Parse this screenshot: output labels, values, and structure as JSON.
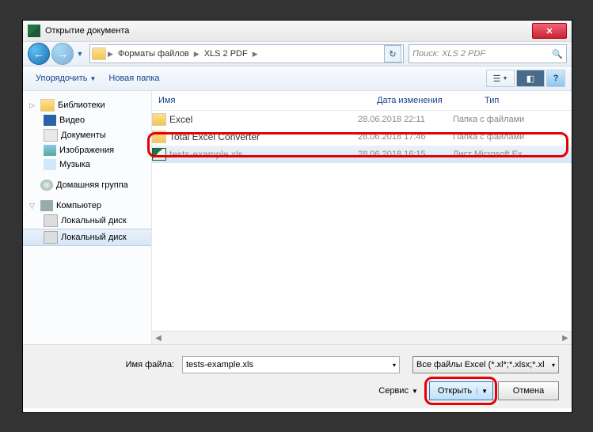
{
  "title": "Открытие документа",
  "breadcrumb": {
    "first": "Форматы файлов",
    "second": "XLS 2 PDF"
  },
  "search_placeholder": "Поиск: XLS 2 PDF",
  "toolbar": {
    "organize": "Упорядочить",
    "new_folder": "Новая папка"
  },
  "sidebar": {
    "libraries": "Библиотеки",
    "video": "Видео",
    "documents": "Документы",
    "images": "Изображения",
    "music": "Музыка",
    "homegroup": "Домашняя группа",
    "computer": "Компьютер",
    "local_disk1": "Локальный диск",
    "local_disk2": "Локальный диск"
  },
  "columns": {
    "name": "Имя",
    "date": "Дата изменения",
    "type": "Тип"
  },
  "files": [
    {
      "name": "Excel",
      "date": "28.06.2018 22:11",
      "type": "Папка с файлами",
      "icon": "folder"
    },
    {
      "name": "Total Excel Converter",
      "date": "28.06.2018 17:46",
      "type": "Папка с файлами",
      "icon": "folder"
    },
    {
      "name": "tests-example.xls",
      "date": "28.06.2018 16:15",
      "type": "Лист Microsoft Ex...",
      "icon": "xls"
    }
  ],
  "filename_label": "Имя файла:",
  "filename_value": "tests-example.xls",
  "filter_value": "Все файлы Excel (*.xl*;*.xlsx;*.xl",
  "service_label": "Сервис",
  "open_label": "Открыть",
  "cancel_label": "Отмена"
}
